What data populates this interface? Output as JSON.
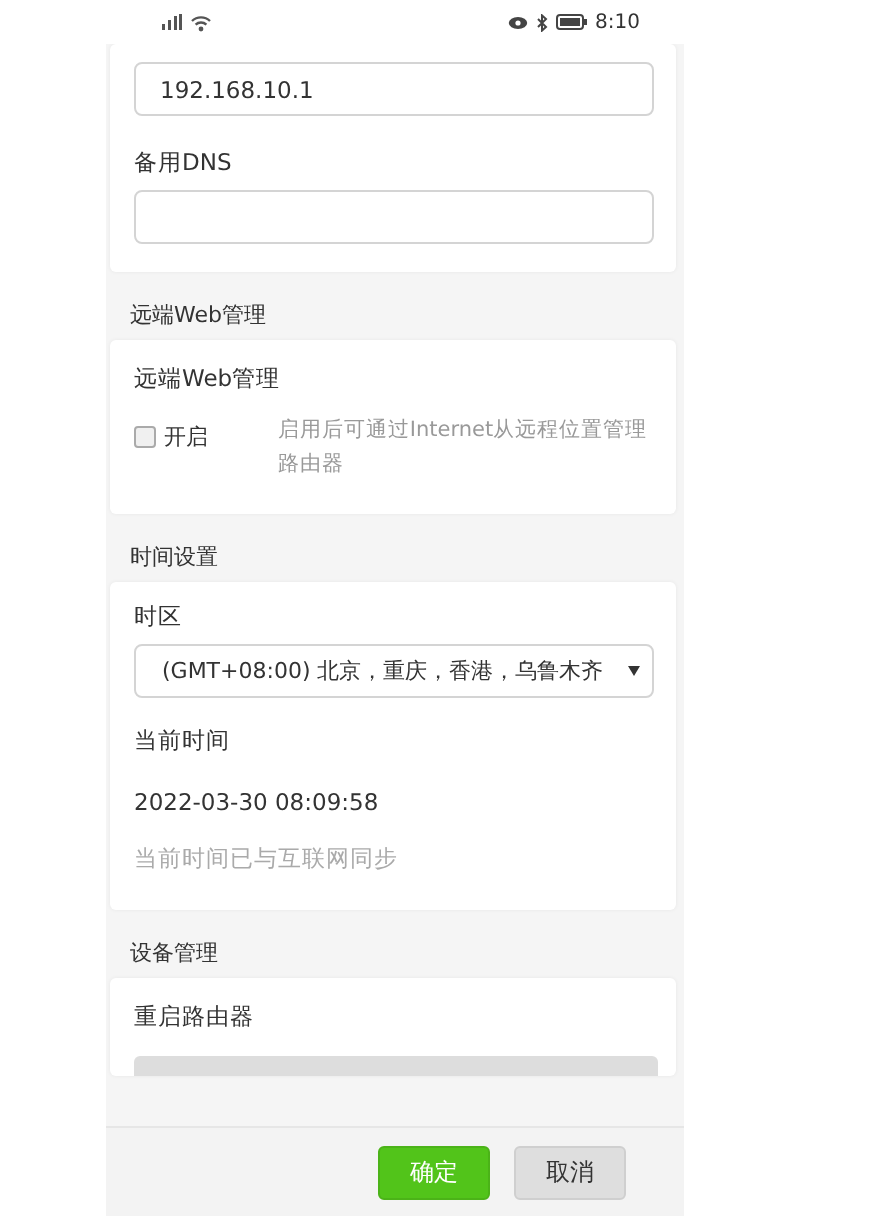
{
  "status_bar": {
    "time": "8:10"
  },
  "dns_card": {
    "fields": [
      {
        "value": "192.168.10.1"
      },
      {
        "label": "备用DNS"
      }
    ]
  },
  "remote_web": {
    "section_title": "远端Web管理",
    "card_title": "远端Web管理",
    "checkbox": {
      "label": "开启",
      "checked": false
    },
    "description": "启用后可通过Internet从远程位置管理路由器"
  },
  "time_settings": {
    "section_title": "时间设置",
    "timezone_label": "时区",
    "timezone_value": "(GMT+08:00) 北京，重庆，香港，乌鲁木齐",
    "current_time_label": "当前时间",
    "current_time": "2022-03-30 08:09:58",
    "sync_note": "当前时间已与互联网同步"
  },
  "device_management": {
    "section_title": "设备管理",
    "card_title": "重启路由器"
  },
  "footer": {
    "buttons": [
      {
        "label": "确定",
        "kind": "primary"
      },
      {
        "label": "取消",
        "kind": "secondary"
      }
    ]
  }
}
